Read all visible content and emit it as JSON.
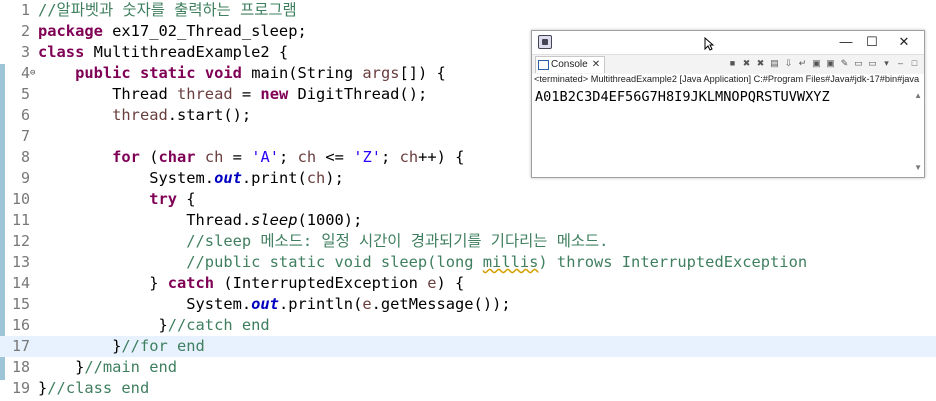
{
  "editor": {
    "lines": [
      {
        "n": "1",
        "tokens": [
          {
            "t": "//알파벳과 숫자를 출력하는 프로그램",
            "c": "cm"
          }
        ]
      },
      {
        "n": "2",
        "tokens": [
          {
            "t": "package",
            "c": "kw"
          },
          {
            "t": " ex17_02_Thread_sleep;",
            "c": ""
          }
        ]
      },
      {
        "n": "3",
        "tokens": [
          {
            "t": "class",
            "c": "kw"
          },
          {
            "t": " MultithreadExample2 {",
            "c": ""
          }
        ]
      },
      {
        "n": "4",
        "fold": "⊖",
        "tokens": [
          {
            "t": "    ",
            "c": ""
          },
          {
            "t": "public",
            "c": "kw"
          },
          {
            "t": " ",
            "c": ""
          },
          {
            "t": "static",
            "c": "kw"
          },
          {
            "t": " ",
            "c": ""
          },
          {
            "t": "void",
            "c": "kw"
          },
          {
            "t": " main(String ",
            "c": ""
          },
          {
            "t": "args",
            "c": "fld2"
          },
          {
            "t": "[]) {",
            "c": ""
          }
        ]
      },
      {
        "n": "5",
        "tokens": [
          {
            "t": "        Thread ",
            "c": ""
          },
          {
            "t": "thread",
            "c": "fld2"
          },
          {
            "t": " = ",
            "c": ""
          },
          {
            "t": "new",
            "c": "kw"
          },
          {
            "t": " DigitThread();",
            "c": ""
          }
        ]
      },
      {
        "n": "6",
        "tokens": [
          {
            "t": "        ",
            "c": ""
          },
          {
            "t": "thread",
            "c": "fld2"
          },
          {
            "t": ".start();",
            "c": ""
          }
        ]
      },
      {
        "n": "7",
        "tokens": []
      },
      {
        "n": "8",
        "tokens": [
          {
            "t": "        ",
            "c": ""
          },
          {
            "t": "for",
            "c": "kw"
          },
          {
            "t": " (",
            "c": ""
          },
          {
            "t": "char",
            "c": "kw"
          },
          {
            "t": " ",
            "c": ""
          },
          {
            "t": "ch",
            "c": "fld2"
          },
          {
            "t": " = ",
            "c": ""
          },
          {
            "t": "'A'",
            "c": "st"
          },
          {
            "t": "; ",
            "c": ""
          },
          {
            "t": "ch",
            "c": "fld2"
          },
          {
            "t": " <= ",
            "c": ""
          },
          {
            "t": "'Z'",
            "c": "st"
          },
          {
            "t": "; ",
            "c": ""
          },
          {
            "t": "ch",
            "c": "fld2"
          },
          {
            "t": "++) {",
            "c": ""
          }
        ]
      },
      {
        "n": "9",
        "tokens": [
          {
            "t": "            System.",
            "c": ""
          },
          {
            "t": "out",
            "c": "sf"
          },
          {
            "t": ".print(",
            "c": ""
          },
          {
            "t": "ch",
            "c": "fld2"
          },
          {
            "t": ");",
            "c": ""
          }
        ]
      },
      {
        "n": "10",
        "tokens": [
          {
            "t": "            ",
            "c": ""
          },
          {
            "t": "try",
            "c": "kw"
          },
          {
            "t": " {",
            "c": ""
          }
        ]
      },
      {
        "n": "11",
        "tokens": [
          {
            "t": "                Thread.",
            "c": ""
          },
          {
            "t": "sleep",
            "c": "sm"
          },
          {
            "t": "(1000);",
            "c": ""
          }
        ]
      },
      {
        "n": "12",
        "tokens": [
          {
            "t": "                ",
            "c": ""
          },
          {
            "t": "//sleep 메소드: 일정 시간이 경과되기를 기다리는 메소드.",
            "c": "cm"
          }
        ]
      },
      {
        "n": "13",
        "tokens": [
          {
            "t": "                ",
            "c": ""
          },
          {
            "t": "//public static void sleep(long ",
            "c": "cm"
          },
          {
            "t": "millis",
            "c": "cm squig"
          },
          {
            "t": ") throws InterruptedException",
            "c": "cm"
          }
        ]
      },
      {
        "n": "14",
        "tokens": [
          {
            "t": "            } ",
            "c": ""
          },
          {
            "t": "catch",
            "c": "kw"
          },
          {
            "t": " (InterruptedException ",
            "c": ""
          },
          {
            "t": "e",
            "c": "fld2"
          },
          {
            "t": ") {",
            "c": ""
          }
        ]
      },
      {
        "n": "15",
        "tokens": [
          {
            "t": "                System.",
            "c": ""
          },
          {
            "t": "out",
            "c": "sf"
          },
          {
            "t": ".println(",
            "c": ""
          },
          {
            "t": "e",
            "c": "fld2"
          },
          {
            "t": ".getMessage());",
            "c": ""
          }
        ]
      },
      {
        "n": "16",
        "tokens": [
          {
            "t": "             }",
            "c": ""
          },
          {
            "t": "//catch end",
            "c": "cm"
          }
        ]
      },
      {
        "n": "17",
        "current": true,
        "tokens": [
          {
            "t": "        }",
            "c": ""
          },
          {
            "t": "//for end",
            "c": "cm"
          }
        ]
      },
      {
        "n": "18",
        "tokens": [
          {
            "t": "    }",
            "c": ""
          },
          {
            "t": "//main end",
            "c": "cm"
          }
        ]
      },
      {
        "n": "19",
        "tokens": [
          {
            "t": "}",
            "c": ""
          },
          {
            "t": "//class end",
            "c": "cm"
          }
        ]
      }
    ]
  },
  "console": {
    "window_controls": {
      "minimize": "—",
      "maximize": "☐",
      "close": "✕"
    },
    "tab_label": "Console",
    "tab_close": "✕",
    "description": "<terminated> MultithreadExample2 [Java Application] C:#Program Files#Java#jdk-17#bin#java",
    "output": "A01B2C3D4EF56G7H8I9JKLMNOPQRSTUVWXYZ",
    "tool_icons": [
      "stop-icon",
      "remove-launch-icon",
      "remove-all-icon",
      "clear-console-icon",
      "scroll-lock-icon",
      "word-wrap-icon",
      "show-on-stdout-icon",
      "show-on-stderr-icon",
      "pin-console-icon",
      "display-selected-icon",
      "new-console-icon",
      "view-menu-icon",
      "minimize-view-icon",
      "maximize-view-icon"
    ]
  },
  "colors": {
    "keyword": "#7f0055",
    "comment": "#3f7f5f",
    "string": "#2a00ff",
    "field": "#0000c0",
    "variable": "#6a3e3e",
    "current_line": "#e8f2fe"
  }
}
